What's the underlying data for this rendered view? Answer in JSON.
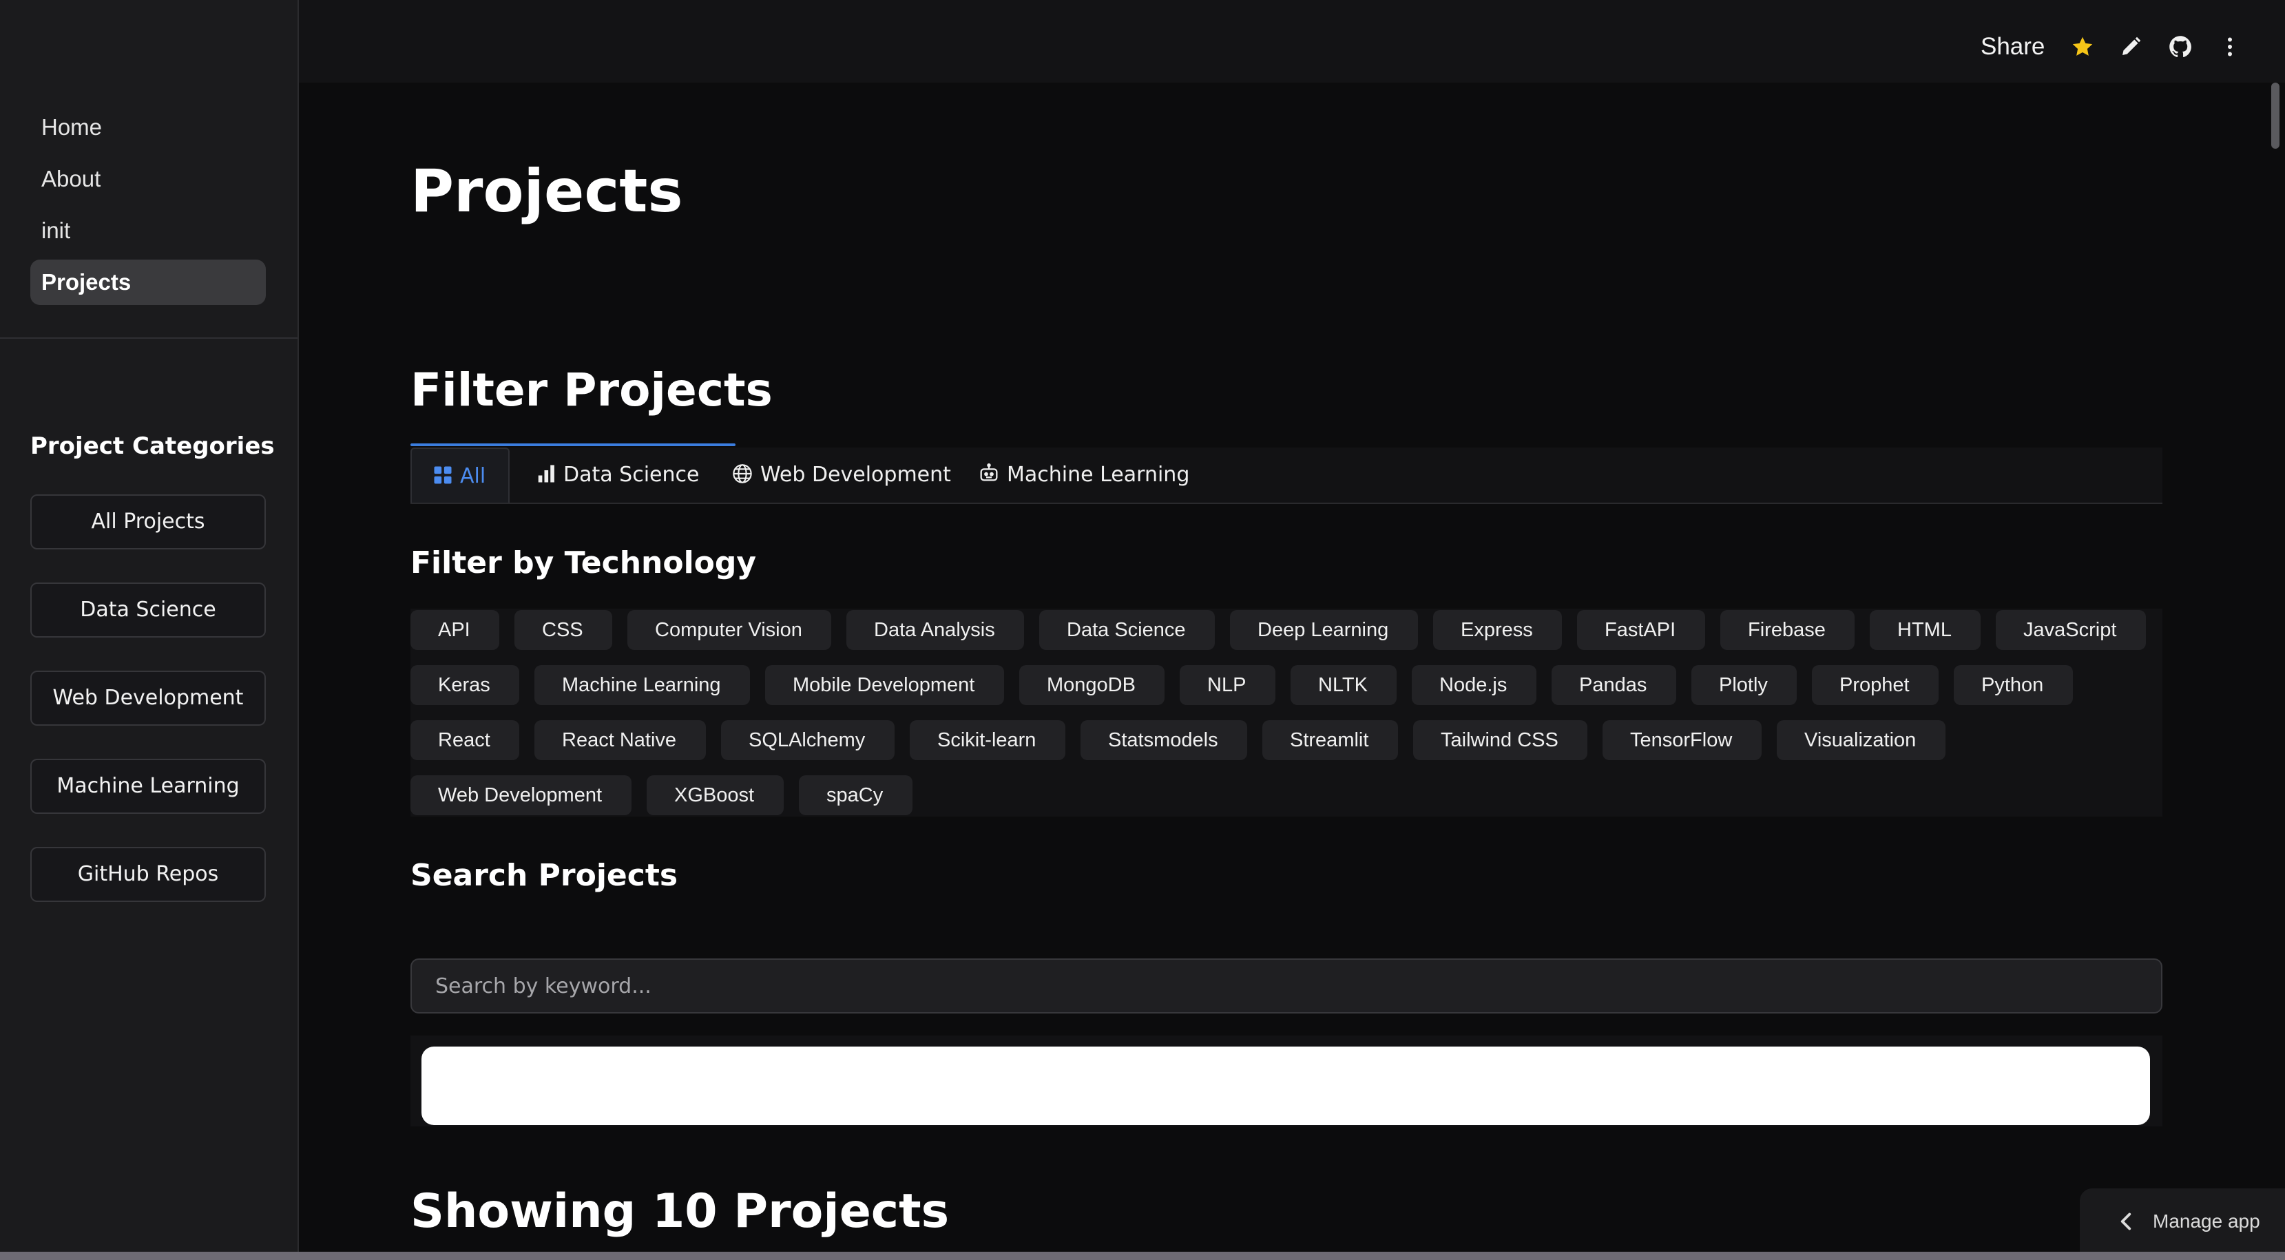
{
  "sidebar": {
    "nav": [
      {
        "label": "Home"
      },
      {
        "label": "About"
      },
      {
        "label": "init"
      },
      {
        "label": "Projects",
        "active": true
      }
    ],
    "categories_title": "Project Categories",
    "categories": [
      "All Projects",
      "Data Science",
      "Web Development",
      "Machine Learning",
      "GitHub Repos"
    ]
  },
  "topbar": {
    "share_label": "Share",
    "icons": [
      "star-icon",
      "pencil-icon",
      "github-icon",
      "kebab-menu-icon"
    ],
    "star_color": "#f5c518"
  },
  "main": {
    "page_title": "Projects",
    "filter_title": "Filter Projects",
    "tabs": [
      {
        "label": "All",
        "icon": "grid-icon",
        "active": true
      },
      {
        "label": "Data Science",
        "icon": "bar-chart-icon"
      },
      {
        "label": "Web Development",
        "icon": "globe-icon"
      },
      {
        "label": "Machine Learning",
        "icon": "robot-icon"
      }
    ],
    "accent_color": "#4c8cf0",
    "tech_title": "Filter by Technology",
    "technologies": [
      [
        "API",
        "CSS",
        "Computer Vision",
        "Data Analysis",
        "Data Science",
        "Deep Learning",
        "Express",
        "FastAPI",
        "Firebase",
        "HTML",
        "JavaScript"
      ],
      [
        "Keras",
        "Machine Learning",
        "Mobile Development",
        "MongoDB",
        "NLP",
        "NLTK",
        "Node.js",
        "Pandas",
        "Plotly",
        "Prophet",
        "Python"
      ],
      [
        "React",
        "React Native",
        "SQLAlchemy",
        "Scikit-learn",
        "Statsmodels",
        "Streamlit",
        "Tailwind CSS",
        "TensorFlow",
        "Visualization"
      ],
      [
        "Web Development",
        "XGBoost",
        "spaCy"
      ]
    ],
    "search_title": "Search Projects",
    "search_placeholder": "Search by keyword...",
    "results_title": "Showing 10 Projects"
  },
  "footer": {
    "manage_label": "Manage app"
  }
}
